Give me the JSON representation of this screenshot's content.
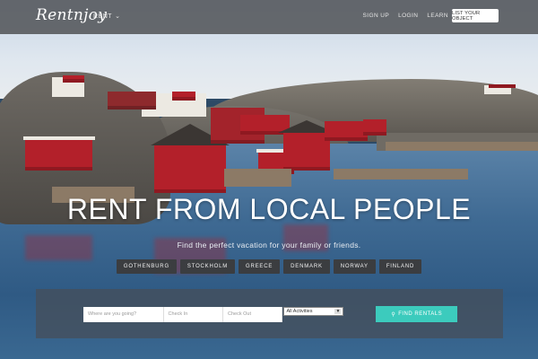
{
  "header": {
    "logo_text": "Rentnjoy",
    "rent_menu_label": "RENT",
    "nav": [
      "SIGN UP",
      "LOGIN",
      "LEARN"
    ],
    "list_button_label": "LIST YOUR OBJECT"
  },
  "hero": {
    "headline": "RENT FROM LOCAL PEOPLE",
    "subline": "Find the perfect vacation for your family or friends.",
    "countries": [
      "GOTHENBURG",
      "STOCKHOLM",
      "GREECE",
      "DENMARK",
      "NORWAY",
      "FINLAND"
    ]
  },
  "search": {
    "destination_placeholder": "Where are you going?",
    "checkin_placeholder": "Check In",
    "checkout_placeholder": "Check Out",
    "activities_selected": "All Activities",
    "find_button_label": "FIND RENTALS"
  },
  "colors": {
    "accent": "#3ccbbd",
    "country_pill": "#3b3d40"
  },
  "icons": {
    "rent_chevron": "chevron-down-icon",
    "find_button": "search-icon",
    "select_arrow": "caret-down-icon"
  }
}
